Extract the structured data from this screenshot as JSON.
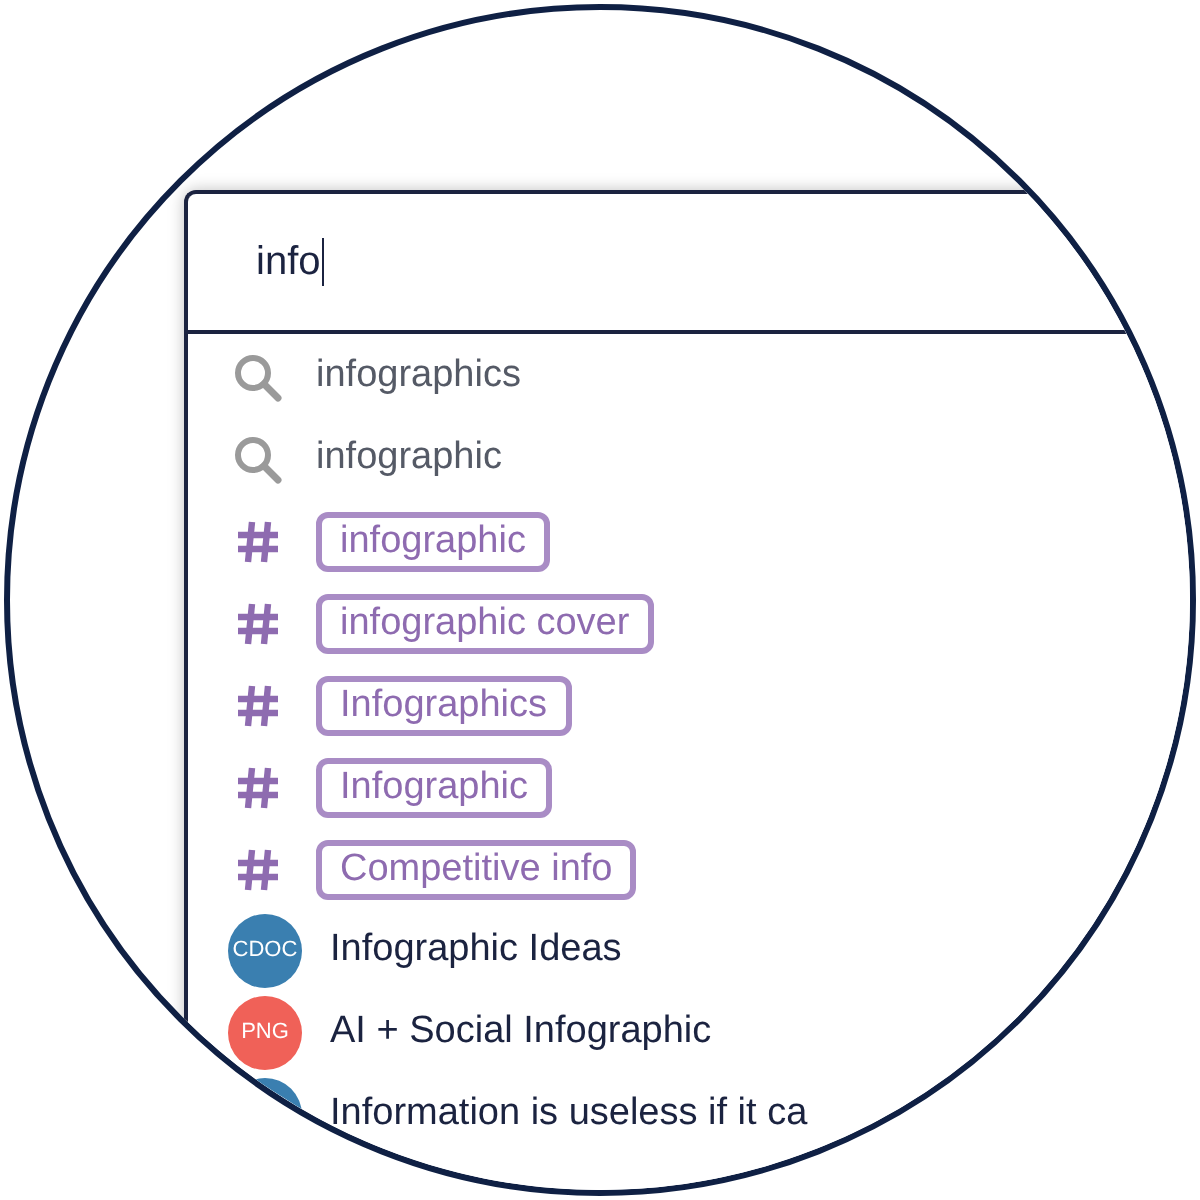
{
  "search": {
    "value": "info"
  },
  "results": [
    {
      "kind": "query",
      "label": "infographics"
    },
    {
      "kind": "query",
      "label": "infographic"
    },
    {
      "kind": "tag",
      "label": "infographic"
    },
    {
      "kind": "tag",
      "label": "infographic cover"
    },
    {
      "kind": "tag",
      "label": "Infographics"
    },
    {
      "kind": "tag",
      "label": "Infographic"
    },
    {
      "kind": "tag",
      "label": "Competitive info"
    },
    {
      "kind": "file",
      "badge": "CDOC",
      "color": "#3a7fb0",
      "label": "Infographic Ideas"
    },
    {
      "kind": "file",
      "badge": "PNG",
      "color": "#f06158",
      "label": "AI + Social Infographic"
    },
    {
      "kind": "file",
      "color": "#3a7fb0",
      "label": "Information is useless if it ca"
    }
  ]
}
